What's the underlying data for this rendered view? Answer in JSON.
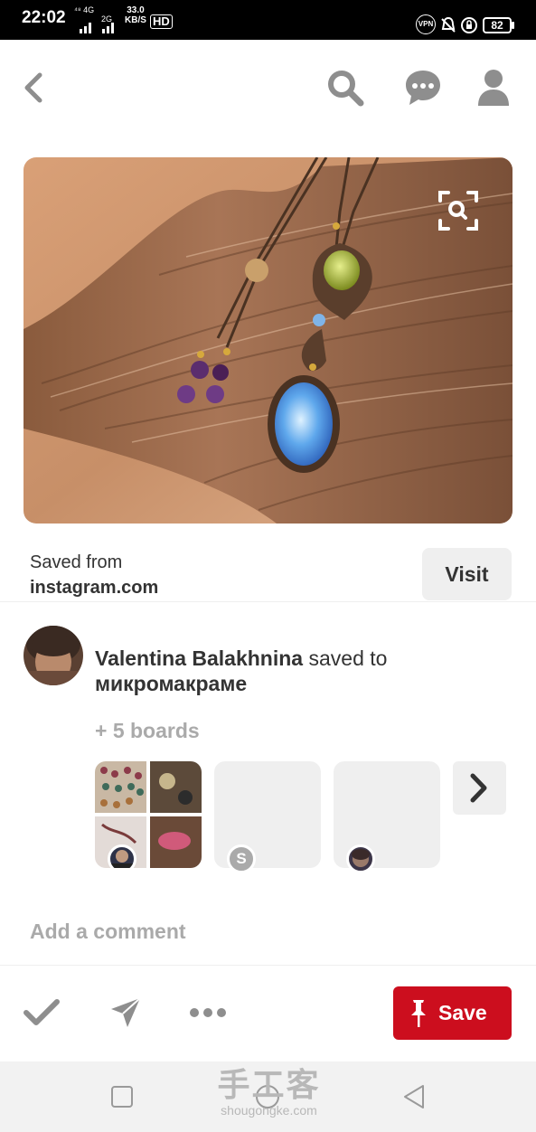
{
  "status_bar": {
    "time": "22:02",
    "network_top": "⁴⁸ 4G",
    "network_bottom": "2G",
    "speed_value": "33.0",
    "speed_unit": "KB/S",
    "hd_label": "HD",
    "vpn_label": "VPN",
    "battery": "82"
  },
  "header": {
    "back_icon": "chevron-left-icon",
    "search_icon": "search-icon",
    "messages_icon": "chat-bubble-icon",
    "profile_icon": "person-icon"
  },
  "pin": {
    "lens_icon": "visual-search-icon",
    "saved_from_label": "Saved from",
    "domain": "instagram.com",
    "visit_label": "Visit"
  },
  "saver": {
    "name": "Valentina Balakhnina",
    "action": " saved to",
    "board": "микромакраме",
    "more_boards": "+ 5 boards",
    "board_badge_letter": "S"
  },
  "comment": {
    "placeholder": "Add a comment"
  },
  "actions": {
    "check_icon": "checkmark-icon",
    "send_icon": "send-icon",
    "more_icon": "more-dots-icon",
    "pin_icon": "pushpin-icon",
    "save_label": "Save"
  },
  "watermark": {
    "chinese": "手工客",
    "url": "shougongke.com"
  },
  "colors": {
    "save_red": "#cc0e1e",
    "icon_gray": "#8e8e8e",
    "light_gray": "#efefef"
  }
}
